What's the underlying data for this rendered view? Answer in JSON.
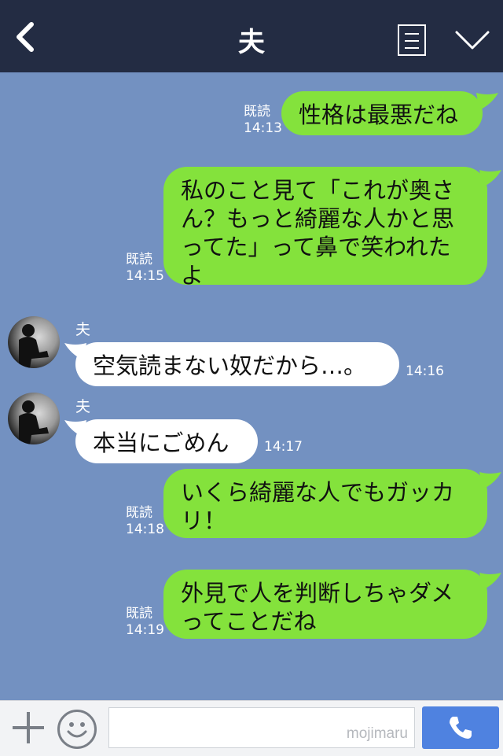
{
  "header": {
    "title": "夫",
    "back_icon": "chevron-left-icon",
    "notes_icon": "notes-icon",
    "menu_icon": "chevron-down-icon"
  },
  "messages": [
    {
      "side": "me",
      "text": "性格は最悪だね",
      "read": "既読",
      "time": "14:13"
    },
    {
      "side": "me",
      "text": "私のこと見て「これが奥さん？もっと綺麗な人かと思ってた」って鼻で笑われたよ",
      "read": "既読",
      "time": "14:15"
    },
    {
      "side": "them",
      "sender": "夫",
      "text": "空気読まない奴だから…。",
      "time": "14:16"
    },
    {
      "side": "them",
      "sender": "夫",
      "text": "本当にごめん",
      "time": "14:17"
    },
    {
      "side": "me",
      "text": "いくら綺麗な人でもガッカリ！",
      "read": "既読",
      "time": "14:18"
    },
    {
      "side": "me",
      "text": "外見で人を判断しちゃダメってことだね",
      "read": "既読",
      "time": "14:19"
    }
  ],
  "footer": {
    "plus_icon": "plus-icon",
    "emoji_icon": "smiley-icon",
    "watermark": "mojimaru",
    "call_icon": "phone-icon"
  },
  "colors": {
    "header_bg": "#232c43",
    "chat_bg": "#7391c1",
    "my_bubble": "#84e23c",
    "their_bubble": "#ffffff",
    "call_button": "#4f82e0"
  }
}
